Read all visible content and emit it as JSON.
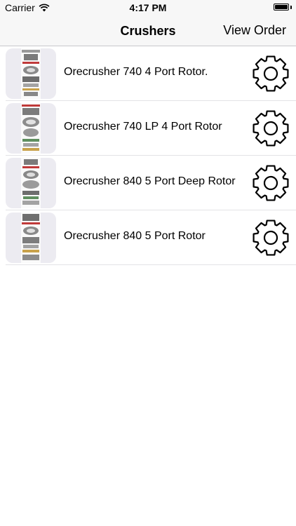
{
  "status_bar": {
    "carrier": "Carrier",
    "time": "4:17 PM",
    "wifi_icon": "wifi-icon",
    "battery_icon": "battery-icon",
    "battery_level": 1.0
  },
  "nav": {
    "title": "Crushers",
    "right_button": "View Order"
  },
  "list": {
    "items": [
      {
        "label": "Orecrusher 740 4 Port Rotor.",
        "thumbnail_icon": "product-thumbnail",
        "action_icon": "gear-icon"
      },
      {
        "label": "Orecrusher 740 LP 4 Port Rotor",
        "thumbnail_icon": "product-thumbnail",
        "action_icon": "gear-icon"
      },
      {
        "label": "Orecrusher 840 5 Port Deep Rotor",
        "thumbnail_icon": "product-thumbnail",
        "action_icon": "gear-icon"
      },
      {
        "label": "Orecrusher 840 5 Port Rotor",
        "thumbnail_icon": "product-thumbnail",
        "action_icon": "gear-icon"
      }
    ]
  },
  "colors": {
    "bar_background": "#f7f7f7",
    "thumbnail_background": "#ecebf1",
    "separator": "#e3e3e6",
    "text": "#000000"
  }
}
